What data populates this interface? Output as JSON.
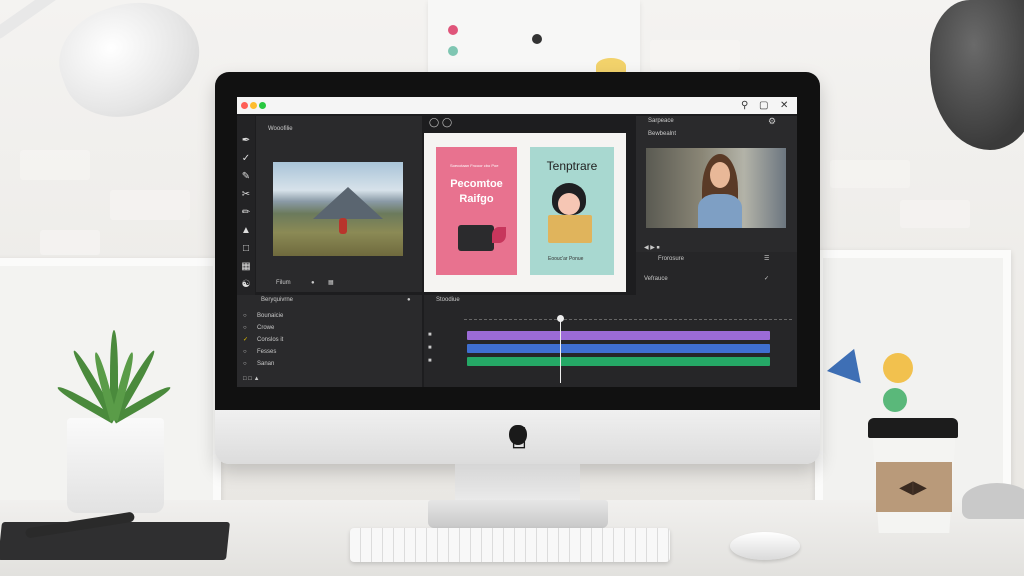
{
  "scene": {
    "poster_dots": [
      "#e0557a",
      "#333333",
      "#7fc6b2"
    ],
    "wall_shapes": [
      "#3e6fb5",
      "#f2c14e",
      "#5ab87a"
    ]
  },
  "app": {
    "window_controls": [
      "#ff5f57",
      "#febc2e",
      "#28c840"
    ],
    "left_panel": {
      "header": "Wooofilie",
      "footer_tab": "Filum"
    },
    "layers_panel": {
      "title": "Beryquivrne",
      "items": [
        "Bounaicie",
        "Crowe",
        "Conslos it",
        "Fesses",
        "Sanan"
      ]
    },
    "canvas": {
      "card1_small": "Soecotaan Fncoor cbo Poe",
      "card1_title": "Pecomtoe Raifgo",
      "card2_title": "Tenptrare",
      "card2_caption": "Eoouc'ar Ponue"
    },
    "right_panel": {
      "header": "Sarpeace",
      "sub_header": "Bewbealnt",
      "properties_label": "Frorosure",
      "vibrance_label": "Vefrauce"
    },
    "timeline": {
      "title": "Stoodiue"
    },
    "track_colors": [
      "#9b6bd6",
      "#3f6fd1",
      "#25a866"
    ]
  }
}
